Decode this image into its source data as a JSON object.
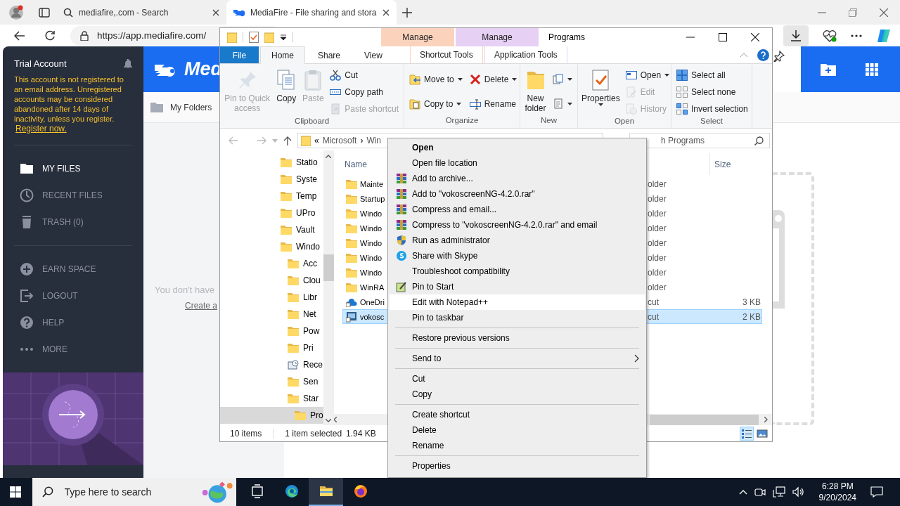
{
  "browser": {
    "tabs": [
      {
        "title": "mediafire,.com - Search",
        "selected": false
      },
      {
        "title": "MediaFire - File sharing and stora",
        "selected": true
      }
    ],
    "address": "https://app.mediafire.com/"
  },
  "mediafire": {
    "account": "Trial Account",
    "warning": "This account is not registered to an email address. Unregistered accounts may be considered abandoned after 14 days of inactivity, unless you register.",
    "register_link": "Register now.",
    "nav": [
      [
        {
          "label": "MY FILES",
          "selected": true
        },
        {
          "label": "RECENT FILES",
          "selected": false
        },
        {
          "label": "TRASH (0)",
          "selected": false
        }
      ],
      [
        {
          "label": "EARN SPACE",
          "selected": false
        },
        {
          "label": "LOGOUT",
          "selected": false
        },
        {
          "label": "HELP",
          "selected": false
        },
        {
          "label": "MORE",
          "selected": false
        }
      ]
    ],
    "logo": "Med",
    "breadcrumb": "My Folders",
    "empty_message": "You don't have",
    "create_link": "Create a"
  },
  "explorer": {
    "title": "Programs",
    "contextual_tabs": [
      {
        "header": "Manage",
        "label": "Shortcut Tools",
        "color": "#fbd3bd"
      },
      {
        "header": "Manage",
        "label": "Application Tools",
        "color": "#e6d0f4"
      }
    ],
    "tabs": [
      {
        "label": "File",
        "kind": "file",
        "selected": false
      },
      {
        "label": "Home",
        "kind": "tab",
        "selected": true
      },
      {
        "label": "Share",
        "kind": "tab",
        "selected": false
      },
      {
        "label": "View",
        "kind": "tab",
        "selected": false
      }
    ],
    "groups": [
      {
        "label": "Clipboard",
        "columns": [
          [
            {
              "label": "Pin to Quick access",
              "kind": "large",
              "disabled": true,
              "dropdown": false
            }
          ],
          [
            {
              "label": "Copy",
              "kind": "large",
              "disabled": false,
              "dropdown": false
            }
          ],
          [
            {
              "label": "Paste",
              "kind": "large",
              "disabled": true,
              "dropdown": false
            }
          ],
          [
            {
              "label": "Cut",
              "kind": "small",
              "disabled": false,
              "dropdown": false
            },
            {
              "label": "Copy path",
              "kind": "small",
              "disabled": false,
              "dropdown": false
            },
            {
              "label": "Paste shortcut",
              "kind": "small",
              "disabled": true,
              "dropdown": false
            }
          ]
        ]
      },
      {
        "label": "Organize",
        "columns": [
          [
            {
              "label": "Move to",
              "kind": "small",
              "disabled": false,
              "dropdown": true
            },
            {
              "label": "Copy to",
              "kind": "small",
              "disabled": false,
              "dropdown": true
            }
          ],
          [
            {
              "label": "Delete",
              "kind": "small",
              "disabled": false,
              "dropdown": true
            },
            {
              "label": "Rename",
              "kind": "small",
              "disabled": false,
              "dropdown": false
            }
          ]
        ]
      },
      {
        "label": "New",
        "columns": [
          [
            {
              "label": "New folder",
              "kind": "large",
              "disabled": false,
              "dropdown": false
            }
          ],
          [
            {
              "kind": "icon",
              "disabled": false,
              "dropdown": true
            },
            {
              "kind": "icon",
              "disabled": false,
              "dropdown": true
            }
          ]
        ]
      },
      {
        "label": "Open",
        "columns": [
          [
            {
              "label": "Properties",
              "kind": "large",
              "disabled": false,
              "dropdown": true
            }
          ],
          [
            {
              "label": "Open",
              "kind": "small",
              "disabled": false,
              "dropdown": true
            },
            {
              "label": "Edit",
              "kind": "small",
              "disabled": true,
              "dropdown": false
            },
            {
              "label": "History",
              "kind": "small",
              "disabled": true,
              "dropdown": false
            }
          ]
        ]
      },
      {
        "label": "Select",
        "columns": [
          [
            {
              "label": "Select all",
              "kind": "small",
              "disabled": false,
              "dropdown": false
            },
            {
              "label": "Select none",
              "kind": "small",
              "disabled": false,
              "dropdown": false
            },
            {
              "label": "Invert selection",
              "kind": "small",
              "disabled": false,
              "dropdown": false
            }
          ]
        ]
      }
    ],
    "path": [
      "«",
      "Microsoft",
      "›",
      "Win"
    ],
    "search": {
      "placeholder": "h Programs"
    },
    "tree": [
      {
        "label": "Statio",
        "kind": "folder",
        "selected": false
      },
      {
        "label": "Syste",
        "kind": "folder",
        "selected": false
      },
      {
        "label": "Temp",
        "kind": "folder",
        "selected": false
      },
      {
        "label": "UPro",
        "kind": "folder",
        "selected": false
      },
      {
        "label": "Vault",
        "kind": "folder",
        "selected": false
      },
      {
        "label": "Windo",
        "kind": "folder",
        "selected": false,
        "children": [
          {
            "label": "Acc",
            "kind": "folder",
            "selected": false
          },
          {
            "label": "Clou",
            "kind": "folder",
            "selected": false
          },
          {
            "label": "Libr",
            "kind": "folder",
            "selected": false
          },
          {
            "label": "Net",
            "kind": "folder",
            "selected": false
          },
          {
            "label": "Pow",
            "kind": "folder",
            "selected": false
          },
          {
            "label": "Pri",
            "kind": "folder",
            "selected": false
          },
          {
            "label": "Rece",
            "kind": "recent",
            "selected": false
          },
          {
            "label": "Sen",
            "kind": "folder",
            "selected": false
          },
          {
            "label": "Star",
            "kind": "folder",
            "selected": false,
            "children": [
              {
                "label": "Pro",
                "kind": "folder",
                "selected": true
              }
            ]
          }
        ]
      }
    ],
    "columns": [
      "Name",
      "Size"
    ],
    "files": [
      {
        "name": "Mainte",
        "type": "older",
        "kind": "folder",
        "selected": false
      },
      {
        "name": "Startup",
        "type": "older",
        "kind": "folder",
        "selected": false
      },
      {
        "name": "Windo",
        "type": "older",
        "kind": "folder",
        "selected": false
      },
      {
        "name": "Windo",
        "type": "older",
        "kind": "folder",
        "selected": false
      },
      {
        "name": "Windo",
        "type": "older",
        "kind": "folder",
        "selected": false
      },
      {
        "name": "Windo",
        "type": "older",
        "kind": "folder",
        "selected": false
      },
      {
        "name": "Windo",
        "type": "older",
        "kind": "folder",
        "selected": false
      },
      {
        "name": "WinRA",
        "type": "older",
        "kind": "folder",
        "selected": false
      },
      {
        "name": "OneDri",
        "type": "cut",
        "size": "3 KB",
        "kind": "cloud",
        "selected": false
      },
      {
        "name": "vokosc",
        "type": "cut",
        "size": "2 KB",
        "kind": "app",
        "selected": true
      }
    ],
    "status": {
      "count": "10 items",
      "selection": "1 item selected",
      "size": "1.94 KB"
    },
    "views": [
      {
        "kind": "details",
        "selected": true
      },
      {
        "kind": "large",
        "selected": false
      }
    ]
  },
  "context_menu": [
    [
      {
        "label": "Open",
        "default": true,
        "highlighted": false,
        "submenu": false
      },
      {
        "label": "Open file location",
        "default": false,
        "highlighted": false,
        "submenu": false
      },
      {
        "label": "Add to archive...",
        "default": false,
        "highlighted": false,
        "submenu": false
      },
      {
        "label": "Add to \"vokoscreenNG-4.2.0.rar\"",
        "default": false,
        "highlighted": false,
        "submenu": false
      },
      {
        "label": "Compress and email...",
        "default": false,
        "highlighted": false,
        "submenu": false
      },
      {
        "label": "Compress to \"vokoscreenNG-4.2.0.rar\" and email",
        "default": false,
        "highlighted": false,
        "submenu": false
      },
      {
        "label": "Run as administrator",
        "default": false,
        "highlighted": false,
        "submenu": false
      },
      {
        "label": "Share with Skype",
        "default": false,
        "highlighted": false,
        "submenu": false
      },
      {
        "label": "Troubleshoot compatibility",
        "default": false,
        "highlighted": false,
        "submenu": false
      },
      {
        "label": "Pin to Start",
        "default": false,
        "highlighted": false,
        "submenu": false
      },
      {
        "label": "Edit with Notepad++",
        "default": false,
        "highlighted": true,
        "submenu": false
      },
      {
        "label": "Pin to taskbar",
        "default": false,
        "highlighted": false,
        "submenu": false
      }
    ],
    [
      {
        "label": "Restore previous versions",
        "default": false,
        "highlighted": false,
        "submenu": false
      }
    ],
    [
      {
        "label": "Send to",
        "default": false,
        "highlighted": false,
        "submenu": true
      }
    ],
    [
      {
        "label": "Cut",
        "default": false,
        "highlighted": false,
        "submenu": false
      },
      {
        "label": "Copy",
        "default": false,
        "highlighted": false,
        "submenu": false
      }
    ],
    [
      {
        "label": "Create shortcut",
        "default": false,
        "highlighted": false,
        "submenu": false
      },
      {
        "label": "Delete",
        "default": false,
        "highlighted": false,
        "submenu": false
      },
      {
        "label": "Rename",
        "default": false,
        "highlighted": false,
        "submenu": false
      }
    ],
    [
      {
        "label": "Properties",
        "default": false,
        "highlighted": false,
        "submenu": false
      }
    ]
  ],
  "taskbar": {
    "search": {
      "placeholder": "Type here to search"
    },
    "apps": [
      {
        "kind": "taskview",
        "active": false
      },
      {
        "kind": "edge",
        "active": false
      },
      {
        "kind": "explorer",
        "active": true
      },
      {
        "kind": "firefox",
        "active": false
      }
    ],
    "time": "6:28 PM",
    "date": "9/20/2024"
  }
}
